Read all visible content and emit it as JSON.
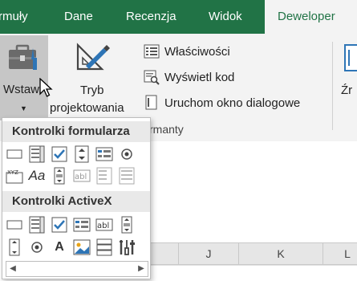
{
  "tabs": [
    {
      "label": "rmuły",
      "active": false
    },
    {
      "label": "Dane",
      "active": false
    },
    {
      "label": "Recenzja",
      "active": false
    },
    {
      "label": "Widok",
      "active": false
    },
    {
      "label": "Deweloper",
      "active": true
    }
  ],
  "ribbon": {
    "insert_label": "Wstaw",
    "design_mode_line1": "Tryb",
    "design_mode_line2": "projektowania",
    "properties_label": "Właściwości",
    "view_code_label": "Wyświetl kod",
    "run_dialog_label": "Uruchom okno dialogowe",
    "group_label": "rmanty",
    "source_label": "Źr"
  },
  "popup": {
    "form_controls_title": "Kontrolki formularza",
    "activex_title": "Kontrolki ActiveX",
    "form_controls": [
      "button",
      "combo-box",
      "check-box",
      "spin-button",
      "list-box",
      "option-button",
      "group-box",
      "label",
      "scroll-bar",
      "text-field",
      "combo-list-edit",
      "combo-dropdown-edit"
    ],
    "activex_controls": [
      "command-button",
      "combo-box",
      "check-box",
      "list-box",
      "text-box",
      "scroll-bar",
      "toggle-button",
      "option-button",
      "label",
      "image",
      "spin-button",
      "more-controls"
    ]
  },
  "sheet": {
    "columns": [
      "J",
      "K",
      "L"
    ]
  },
  "colors": {
    "tab_green": "#217346",
    "ribbon_bg": "#f3f3f3"
  }
}
